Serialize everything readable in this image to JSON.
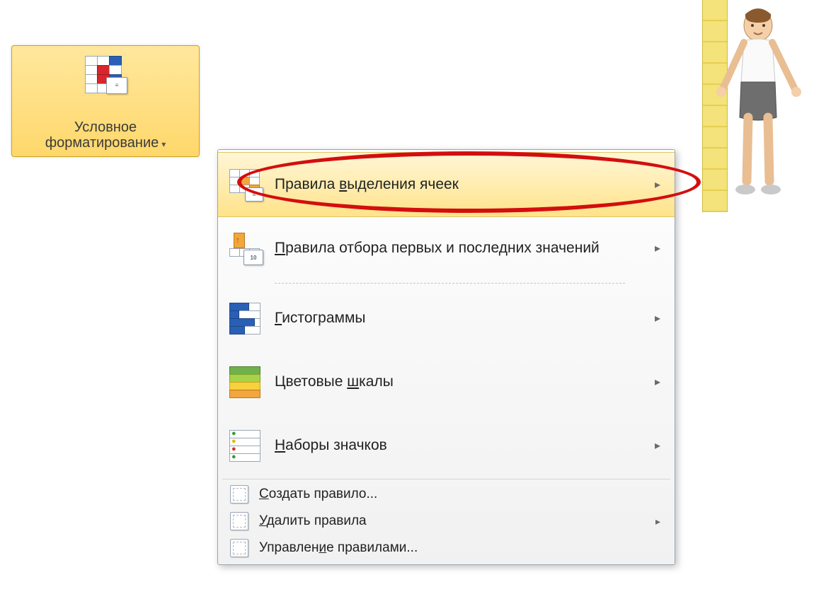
{
  "ribbon": {
    "label_line1": "Условное",
    "label_line2": "форматирование"
  },
  "menu": {
    "items": [
      {
        "label": "Правила выделения ячеек",
        "mnemonic_index": 8,
        "has_submenu": true,
        "hover": true,
        "icon": "highlight-cells-icon"
      },
      {
        "label": "Правила отбора первых и последних значений",
        "mnemonic_index": 0,
        "has_submenu": true,
        "icon": "top-bottom-icon",
        "separator_after": "dotted"
      },
      {
        "label": "Гистограммы",
        "mnemonic_index": 0,
        "has_submenu": true,
        "icon": "databars-icon"
      },
      {
        "label": "Цветовые шкалы",
        "mnemonic_index": 9,
        "has_submenu": true,
        "icon": "color-scales-icon"
      },
      {
        "label": "Наборы значков",
        "mnemonic_index": 0,
        "has_submenu": true,
        "icon": "icon-sets-icon",
        "separator_after": "solid"
      }
    ],
    "small_items": [
      {
        "label": "Создать правило...",
        "mnemonic_index": 0,
        "icon": "new-rule-icon"
      },
      {
        "label": "Удалить правила",
        "mnemonic_index": 0,
        "has_submenu": true,
        "icon": "clear-rules-icon"
      },
      {
        "label": "Управление правилами...",
        "mnemonic_index": 8,
        "icon": "manage-rules-icon"
      }
    ]
  },
  "arrow_glyph": "▸",
  "caret_glyph": "▾"
}
